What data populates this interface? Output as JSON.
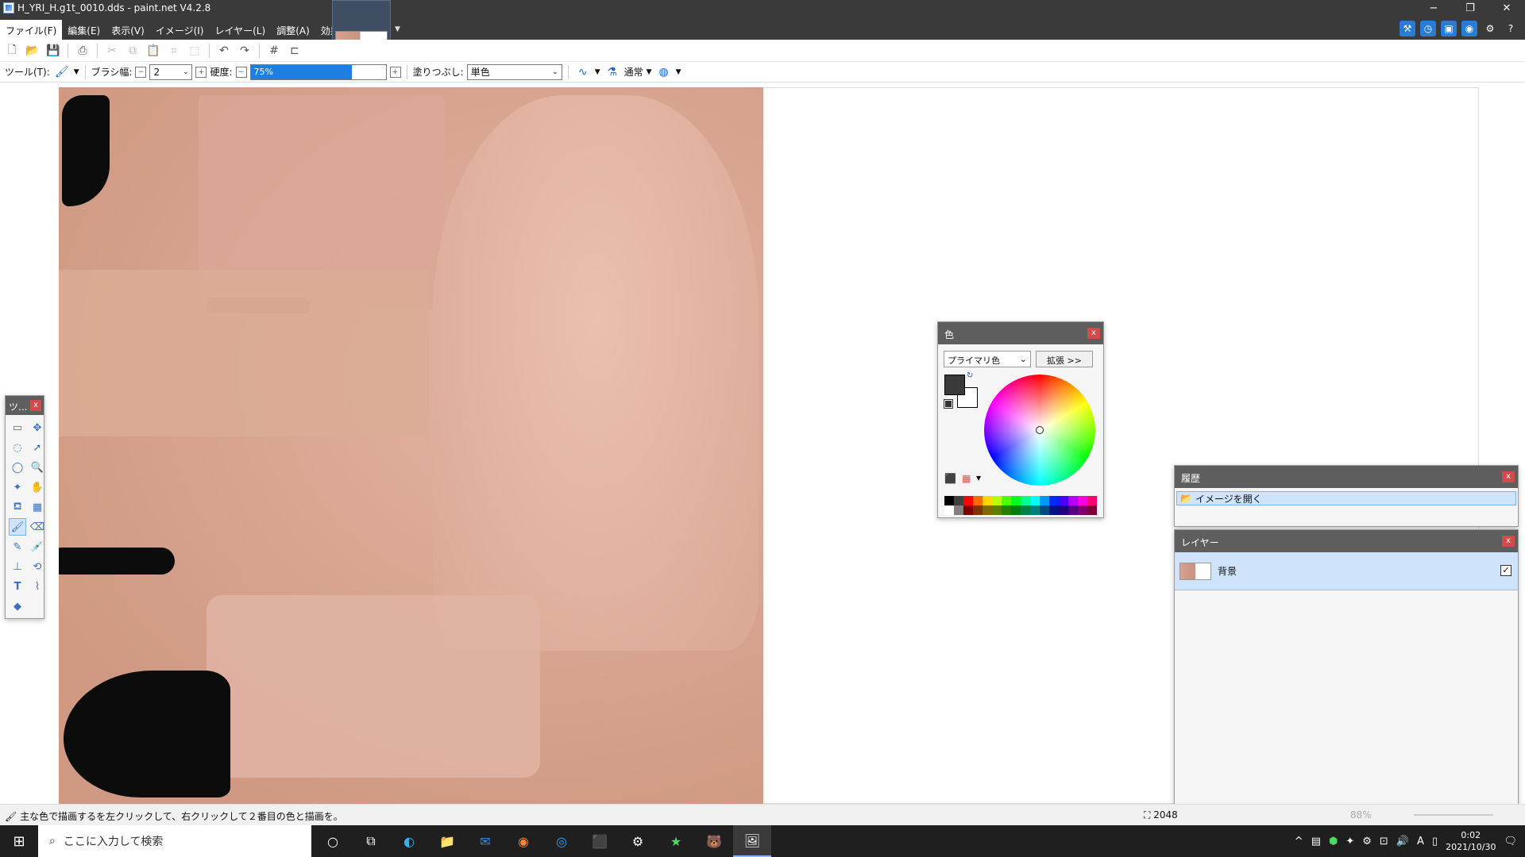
{
  "window": {
    "title": "H_YRI_H.g1t_0010.dds - paint.net V4.2.8",
    "controls": [
      "−",
      "❐",
      "✕"
    ]
  },
  "menu": {
    "items": [
      "ファイル(F)",
      "編集(E)",
      "表示(V)",
      "イメージ(I)",
      "レイヤー(L)",
      "調整(A)",
      "効果(C)"
    ]
  },
  "toolbar2": {
    "tool_label": "ツール(T):",
    "brush_width_label": "ブラシ幅:",
    "brush_width_value": "2",
    "hardness_label": "硬度:",
    "hardness_value": "75%",
    "hardness_fraction": 0.75,
    "fill_label": "塗りつぶし:",
    "fill_value": "単色",
    "blend_mode_value": "通常"
  },
  "tools_window": {
    "title": "ツ...",
    "close": "x"
  },
  "color_window": {
    "title": "色",
    "close": "x",
    "mode_value": "プライマリ色",
    "expand_label": "拡張 >>",
    "primary_color": "#3a3a3a",
    "secondary_color": "#ffffff",
    "palette": [
      "#000000",
      "#404040",
      "#ff0000",
      "#ff6a00",
      "#ffd800",
      "#b6ff00",
      "#4cff00",
      "#00ff21",
      "#00ff90",
      "#00ffff",
      "#0094ff",
      "#0026ff",
      "#4800ff",
      "#b200ff",
      "#ff00dc",
      "#ff006e",
      "#ffffff",
      "#808080",
      "#7f0000",
      "#7f3300",
      "#7f6a00",
      "#5b7f00",
      "#267f00",
      "#007f0e",
      "#007f46",
      "#007f7f",
      "#004a7f",
      "#00137f",
      "#21007f",
      "#57007f",
      "#7f006e",
      "#7f0037"
    ]
  },
  "history_window": {
    "title": "履歴",
    "close": "x",
    "items": [
      "イメージを開く"
    ]
  },
  "layers_window": {
    "title": "レイヤー",
    "close": "x",
    "layers": [
      {
        "name": "背景",
        "visible": true
      }
    ]
  },
  "status": {
    "hint": "主な色で描画するを左クリックして、右クリックして２番目の色と描画を。",
    "image_size": "2048",
    "zoom": "88%"
  },
  "taskbar": {
    "search_placeholder": "ここに入力して検索",
    "time": "0:02",
    "date": "2021/10/30",
    "ime": "A"
  }
}
